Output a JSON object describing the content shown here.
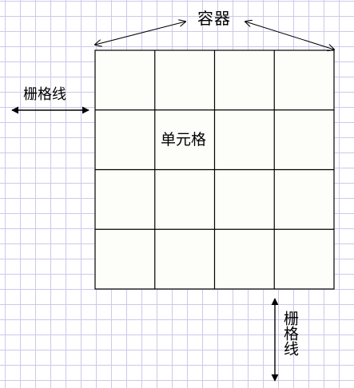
{
  "labels": {
    "container": "容器",
    "gridline_horizontal": "栅格线",
    "cell": "单元格",
    "gridline_vertical": "栅格线"
  },
  "grid": {
    "rows": 4,
    "columns": 4
  },
  "colors": {
    "background": "#ffffff",
    "background_grid": "#cfc8ea",
    "container_fill": "#fdfdf9",
    "lines": "#000000"
  }
}
